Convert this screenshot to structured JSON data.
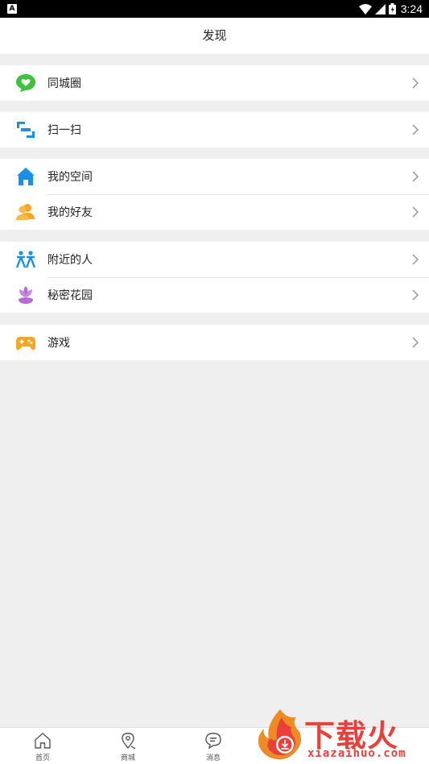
{
  "status_bar": {
    "app_badge": "A",
    "time": "3:24"
  },
  "header": {
    "title": "发现"
  },
  "groups": [
    {
      "items": [
        {
          "label": "同城圈",
          "icon": "chat-heart-icon"
        }
      ]
    },
    {
      "items": [
        {
          "label": "扫一扫",
          "icon": "scan-icon"
        }
      ]
    },
    {
      "items": [
        {
          "label": "我的空间",
          "icon": "home-icon"
        },
        {
          "label": "我的好友",
          "icon": "friends-icon"
        }
      ]
    },
    {
      "items": [
        {
          "label": "附近的人",
          "icon": "people-nearby-icon"
        },
        {
          "label": "秘密花园",
          "icon": "flower-icon"
        }
      ]
    },
    {
      "items": [
        {
          "label": "游戏",
          "icon": "gamepad-icon"
        }
      ]
    }
  ],
  "tabs": [
    {
      "label": "首页",
      "icon": "home-outline-icon"
    },
    {
      "label": "商城",
      "icon": "location-icon"
    },
    {
      "label": "消息",
      "icon": "message-icon"
    }
  ],
  "watermark": {
    "logo_text": "下载火",
    "site": "xiazaihuo.com"
  },
  "colors": {
    "green": "#3cc23c",
    "blue": "#1a8fe6",
    "orange": "#f6a623",
    "purple": "#b26cd6",
    "watermark_red": "#e8413a"
  }
}
